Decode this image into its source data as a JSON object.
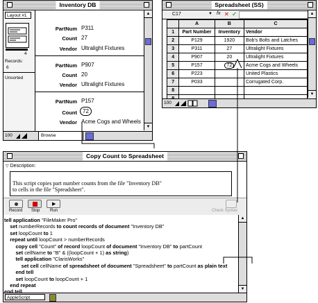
{
  "inventory": {
    "title": "Inventory DB",
    "layout_label": "Layout #1",
    "records_label": "Records:",
    "records_count": "6",
    "sort_status": "Unsorted",
    "stack_number": "4",
    "zoom": "100",
    "mode": "Browse",
    "records": [
      {
        "partnum_label": "PartNum",
        "partnum": "P311",
        "count_label": "Count",
        "count": "27",
        "vendor_label": "Vendor",
        "vendor": "Ultralight Fixtures"
      },
      {
        "partnum_label": "PartNum",
        "partnum": "P907",
        "count_label": "Count",
        "count": "20",
        "vendor_label": "Vendor",
        "vendor": "Ultralight Fixtures"
      },
      {
        "partnum_label": "PartNum",
        "partnum": "P157",
        "count_label": "Count",
        "count": "72",
        "vendor_label": "Vendor",
        "vendor": "Acme Cogs and Wheels"
      }
    ]
  },
  "spreadsheet": {
    "title": "Spreadsheet (SS)",
    "cell_ref": "C17",
    "fx": "fx",
    "cancel": "✕",
    "accept": "✓",
    "columns": [
      "A",
      "B",
      "C"
    ],
    "headers": [
      "Part Number",
      "Inventory",
      "Vendor"
    ],
    "rows": [
      [
        "P129",
        "1920",
        "Bob's Bolts and Latches"
      ],
      [
        "P311",
        "27",
        "Ultralight Fixtures"
      ],
      [
        "P907",
        "20",
        "Ultralight Fixtures"
      ],
      [
        "P157",
        "72",
        "Acme Cogs and Wheels"
      ],
      [
        "P223",
        "",
        "United Plastics"
      ],
      [
        "P033",
        "",
        "Corrugated Corp."
      ],
      [
        "",
        "",
        ""
      ],
      [
        "",
        "",
        ""
      ],
      [
        "",
        "",
        ""
      ],
      [
        "",
        "",
        ""
      ],
      [
        "",
        "",
        ""
      ]
    ],
    "row_numbers": [
      "1",
      "2",
      "3",
      "4",
      "5",
      "6",
      "7",
      "8",
      "9",
      "10",
      "11",
      "12"
    ],
    "zoom": "100"
  },
  "script_window": {
    "title": "Copy Count to Spreadsheet",
    "description_label": "Description:",
    "description_text": "This script copies part number counts from the file \"Inventory DB\"\nto cells in the file \"Spreadsheet\".",
    "record_label": "Record",
    "stop_label": "Stop",
    "run_label": "Run",
    "check_syntax_label": "Check Syntax",
    "language": "AppleScript",
    "code_lines": [
      "tell application \"FileMaker Pro\"",
      "    set numberRecords to count records of document \"Inventory DB\"",
      "    set loopCount to 1",
      "    repeat until loopCount > numberRecords",
      "        copy cell \"Count\" of record loopCount of document \"Inventory DB\" to partCount",
      "        set cellName to \"B\" & ((loopCount + 1) as string)",
      "        tell application \"ClarisWorks\"",
      "            set cell cellName of spreadsheet of document \"Spreadsheet\" to partCount as plain text",
      "        end tell",
      "        set loopCount to loopCount + 1",
      "    end repeat",
      "end tell"
    ]
  }
}
